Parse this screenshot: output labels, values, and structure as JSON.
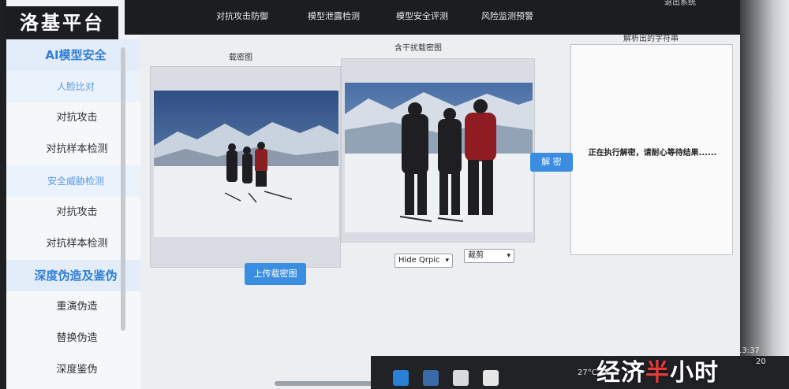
{
  "brand": "洛基平台",
  "sidebar": {
    "items": [
      {
        "label": "AI模型安全",
        "kind": "group"
      },
      {
        "label": "人脸比对",
        "kind": "sub"
      },
      {
        "label": "对抗攻击",
        "kind": "item"
      },
      {
        "label": "对抗样本检测",
        "kind": "item"
      },
      {
        "label": "安全威胁检测",
        "kind": "sub"
      },
      {
        "label": "对抗攻击",
        "kind": "item"
      },
      {
        "label": "对抗样本检测",
        "kind": "item"
      },
      {
        "label": "深度伪造及鉴伪",
        "kind": "group"
      },
      {
        "label": "重演伪造",
        "kind": "item"
      },
      {
        "label": "替换伪造",
        "kind": "item"
      },
      {
        "label": "深度鉴伪",
        "kind": "item"
      }
    ]
  },
  "topnav": {
    "tabs": [
      "对抗攻击防御",
      "模型泄露检测",
      "模型安全评测",
      "风险监测预警"
    ],
    "logout": "退出系统"
  },
  "main": {
    "carrier_label": "载密图",
    "stego_label": "含干扰载密图",
    "result_label": "解析出的字符串",
    "result_text": "正在执行解密，请耐心等待结果......",
    "upload_button": "上传载密图",
    "decrypt_button": "解 密",
    "mode_select": "Hide Qrpic",
    "crop_select": "裁剪"
  },
  "taskbar": {
    "time": "13:37",
    "date": "20",
    "temperature": "27°C",
    "watermark_a": "经济",
    "watermark_b": "半",
    "watermark_c": "小时"
  },
  "colors": {
    "accent": "#3a8de0",
    "nav_bg": "#1b1d21",
    "watermark_red": "#e23b3b"
  }
}
